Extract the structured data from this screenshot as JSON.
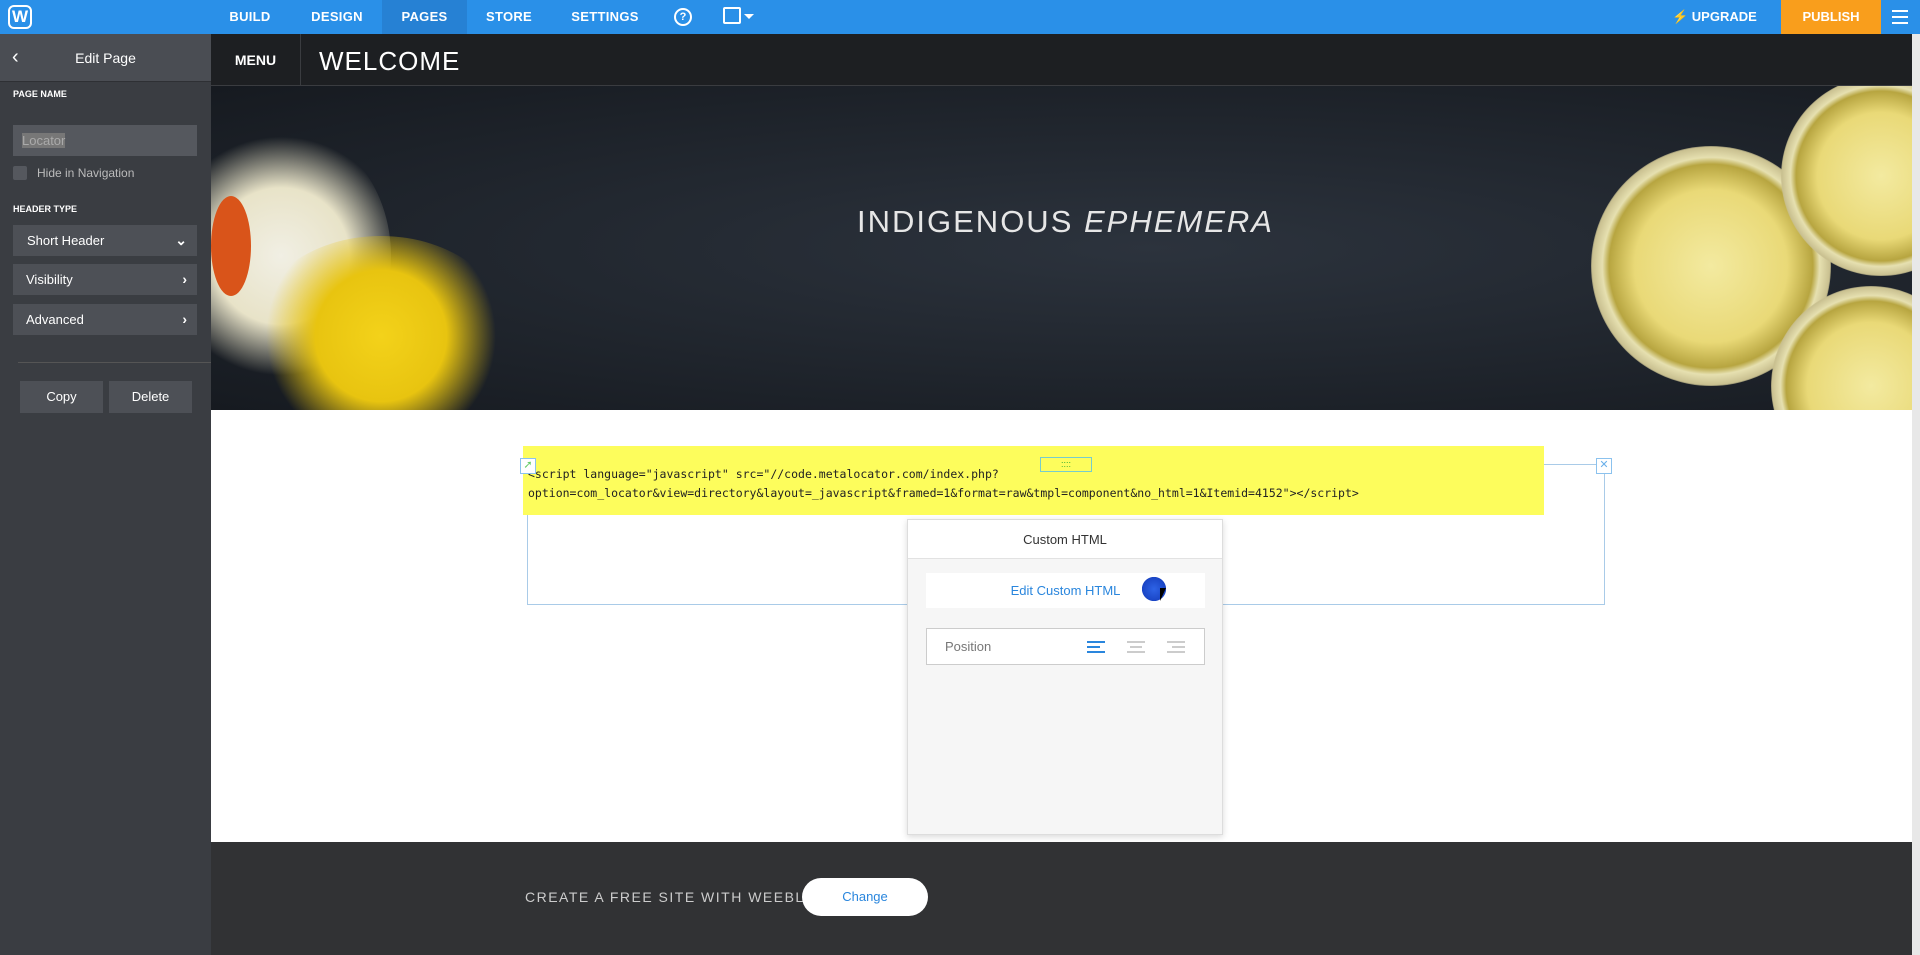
{
  "topbar": {
    "logo": "W",
    "nav": [
      "BUILD",
      "DESIGN",
      "PAGES",
      "STORE",
      "SETTINGS"
    ],
    "active": "PAGES",
    "help": "?",
    "upgrade": "⚡ UPGRADE",
    "publish": "PUBLISH",
    "accent": "#2a90e8",
    "publish_color": "#f99e1c"
  },
  "sidebar": {
    "back": "‹",
    "title": "Edit Page",
    "page_name_label": "PAGE NAME",
    "page_name_value": "Locator",
    "hide_nav": "Hide in Navigation",
    "header_type_label": "HEADER TYPE",
    "header_type": "Short Header",
    "visibility": "Visibility",
    "advanced": "Advanced",
    "copy": "Copy",
    "delete": "Delete"
  },
  "site": {
    "menu": "MENU",
    "welcome": "WELCOME",
    "hero_title_1": "INDIGENOUS ",
    "hero_title_2": "EPHEMERA"
  },
  "block": {
    "code_line1": "<script language=\"javascript\" src=\"//code.metalocator.com/index.php?",
    "code_line2": "option=com_locator&view=directory&layout=_javascript&framed=1&format=raw&tmpl=component&no_html=1&Itemid=4152\"></script>",
    "handle": "::::",
    "close": "✕"
  },
  "popup": {
    "title": "Custom HTML",
    "edit": "Edit Custom HTML",
    "position": "Position"
  },
  "footer": {
    "text": "CREATE A FREE SITE WITH WEEBLY",
    "change": "Change"
  }
}
